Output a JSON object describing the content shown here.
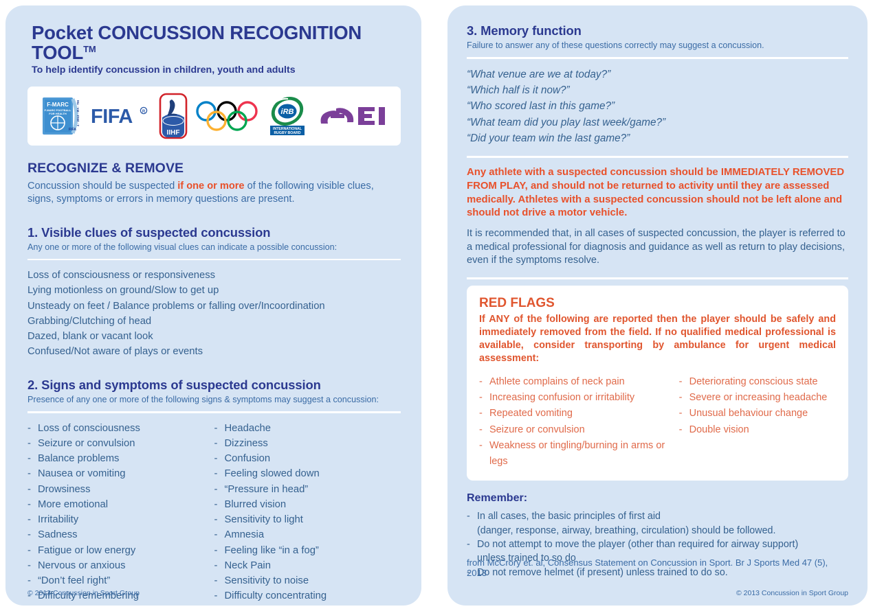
{
  "header": {
    "title_lead": "Pocket ",
    "title_main": "CONCUSSION RECOGNITION TOOL",
    "title_tm": "TM",
    "subtitle": "To help identify concussion in children, youth and adults"
  },
  "logos": [
    {
      "name": "f-marc-logo",
      "label": "F-MARC"
    },
    {
      "name": "fifa-logo",
      "label": "FIFA"
    },
    {
      "name": "iihf-logo",
      "label": "IIHF"
    },
    {
      "name": "olympic-rings-logo",
      "label": "Olympic Rings"
    },
    {
      "name": "irb-logo",
      "label": "IRB International Rugby Board"
    },
    {
      "name": "fei-logo",
      "label": "FEI"
    }
  ],
  "recognize": {
    "heading": "RECOGNIZE & REMOVE",
    "intro_part1": "Concussion should be suspected ",
    "intro_accent": "if one or more",
    "intro_part2": " of the following visible clues, signs, symptoms or errors in memory questions are present."
  },
  "section1": {
    "heading": "1. Visible clues of suspected concussion",
    "subnote": "Any one or more of the following visual clues can indicate a possible concussion:",
    "items": [
      "Loss of consciousness or responsiveness",
      "Lying motionless on ground/Slow to get up",
      "Unsteady on feet / Balance problems or falling over/Incoordination",
      "Grabbing/Clutching of head",
      "Dazed, blank or vacant look",
      "Confused/Not aware of plays or events"
    ]
  },
  "section2": {
    "heading": "2. Signs and symptoms of suspected concussion",
    "subnote": "Presence of any one or more of the following signs & symptoms may suggest a concussion:",
    "column_left": [
      "Loss of consciousness",
      "Seizure or convulsion",
      "Balance problems",
      "Nausea or vomiting",
      "Drowsiness",
      "More emotional",
      "Irritability",
      "Sadness",
      "Fatigue or low energy",
      "Nervous or anxious",
      "“Don’t feel right”",
      "Difficulty remembering"
    ],
    "column_right": [
      "Headache",
      "Dizziness",
      "Confusion",
      "Feeling slowed down",
      "“Pressure in head”",
      "Blurred vision",
      "Sensitivity to light",
      "Amnesia",
      "Feeling like “in a fog”",
      "Neck Pain",
      "Sensitivity to noise",
      "Difficulty concentrating"
    ]
  },
  "section3": {
    "heading": "3. Memory function",
    "subnote": "Failure to answer any of these questions correctly may suggest a concussion.",
    "questions": [
      "“What venue are we at today?”",
      "“Which half is it now?”",
      "“Who scored last in this game?”",
      "“What team did you play last week/game?”",
      "“Did your team win the last game?”"
    ]
  },
  "warning": {
    "red_text": "Any athlete with a suspected concussion should be IMMEDIATELY REMOVED FROM PLAY, and should not be returned to activity until they are assessed medically.  Athletes with a suspected concussion should not be left alone and should not drive a motor vehicle.",
    "recommend_text": "It is recommended that, in all cases of suspected concussion, the player is referred to a medical professional for diagnosis and guidance as well as return to play decisions, even if the symptoms resolve."
  },
  "red_flags": {
    "title": "RED FLAGS",
    "intro": "If ANY of the following are reported then the player should be safely and immediately removed from the field. If no qualified medical professional is available, consider transporting by ambulance for urgent medical assessment:",
    "column_left": [
      "Athlete complains of neck pain",
      "Increasing confusion or irritability",
      "Repeated vomiting",
      "Seizure or convulsion",
      "Weakness or tingling/burning in arms or legs"
    ],
    "column_right": [
      "Deteriorating conscious state",
      "Severe or increasing headache",
      "Unusual behaviour change",
      "Double vision"
    ]
  },
  "remember": {
    "heading": "Remember:",
    "items": [
      {
        "line1": "In all cases, the basic principles of first aid",
        "line2": "(danger, response, airway, breathing, circulation) should be followed."
      },
      {
        "line1": "Do not attempt to move the player (other than required for airway support)",
        "line2": "unless trained to so do"
      },
      {
        "line1": "Do not remove helmet (if present) unless trained to do so.",
        "line2": ""
      }
    ]
  },
  "footer": {
    "citation": "from McCrory et. al, Consensus Statement on Concussion in Sport. Br J Sports Med 47 (5), 2013",
    "copyright_left": "© 2013 Concussion in Sport Group",
    "copyright_right": "© 2013 Concussion in Sport Group"
  },
  "colors": {
    "panel_bg": "#d6e4f4",
    "heading_blue": "#2b3990",
    "body_blue": "#35618f",
    "accent_red": "#e8512b",
    "redflag_red": "#e06a4a"
  }
}
